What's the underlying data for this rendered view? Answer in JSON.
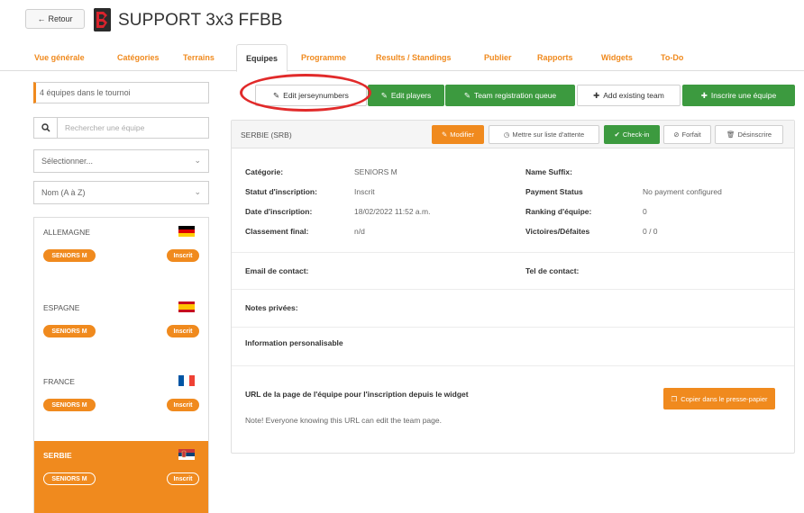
{
  "header": {
    "back_label": "Retour",
    "title": "SUPPORT 3x3 FFBB"
  },
  "nav": {
    "tabs": [
      {
        "label": "Vue générale"
      },
      {
        "label": "Catégories"
      },
      {
        "label": "Terrains"
      },
      {
        "label": "Equipes",
        "active": true
      },
      {
        "label": "Programme"
      },
      {
        "label": "Results / Standings"
      },
      {
        "label": "Publier"
      },
      {
        "label": "Rapports"
      },
      {
        "label": "Widgets"
      },
      {
        "label": "To-Do"
      }
    ]
  },
  "sidebar": {
    "team_count": "4 équipes dans le tournoi",
    "search_placeholder": "Rechercher une équipe",
    "select_filter": "Sélectionner...",
    "select_sort": "Nom (A à Z)",
    "teams": [
      {
        "name": "ALLEMAGNE",
        "category": "SENIORS M",
        "status": "Inscrit",
        "flag": "germany"
      },
      {
        "name": "ESPAGNE",
        "category": "SENIORS M",
        "status": "Inscrit",
        "flag": "spain"
      },
      {
        "name": "FRANCE",
        "category": "SENIORS M",
        "status": "Inscrit",
        "flag": "france"
      },
      {
        "name": "SERBIE",
        "category": "SENIORS M",
        "status": "Inscrit",
        "flag": "serbia",
        "active": true
      }
    ]
  },
  "actions": {
    "edit_jersey": "Edit jerseynumbers",
    "edit_players": "Edit players",
    "team_registration_queue": "Team registration queue",
    "add_existing_team": "Add existing team",
    "register_team": "Inscrire une équipe"
  },
  "panel": {
    "title": "SERBIE (SRB)",
    "buttons": {
      "modify": "Modifier",
      "waiting_list": "Mettre sur liste d'attente",
      "checkin": "Check-in",
      "forfeit": "Forfait",
      "unregister": "Désinscrire"
    },
    "fields": {
      "category_label": "Catégorie:",
      "category_value": "SENIORS M",
      "status_label": "Statut d'inscription:",
      "status_value": "Inscrit",
      "date_label": "Date d'inscription:",
      "date_value": "18/02/2022 11:52 a.m.",
      "final_label": "Classement final:",
      "final_value": "n/d",
      "suffix_label": "Name Suffix:",
      "payment_label": "Payment Status",
      "payment_value": "No payment configured",
      "ranking_label": "Ranking d'équipe:",
      "ranking_value": "0",
      "wins_label": "Victoires/Défaites",
      "wins_value": "0 / 0",
      "email_label": "Email de contact:",
      "tel_label": "Tel de contact:",
      "notes_label": "Notes privées:",
      "custom_label": "Information personalisable"
    },
    "url": {
      "label": "URL de la page de l'équipe pour l'inscription depuis le widget",
      "note": "Note! Everyone knowing this URL can edit the team page.",
      "copy_button": "Copier dans le presse-papier"
    }
  },
  "colors": {
    "accent": "#f08a1e",
    "green": "#3c9a3f",
    "highlight": "#e12a2a"
  }
}
